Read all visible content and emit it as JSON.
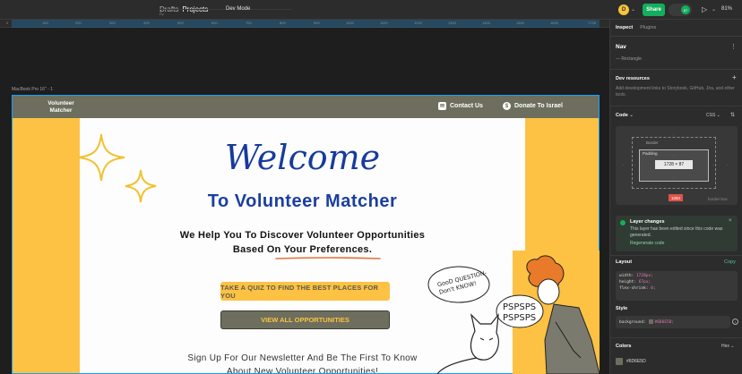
{
  "topbar": {
    "breadcrumb": [
      "Drafts",
      "Projects"
    ],
    "dev_mode": "Dev Mode",
    "avatar_initial": "D",
    "share_label": "Share",
    "users_count": "87",
    "zoom": "81%"
  },
  "ruler": {
    "ticks": [
      "0",
      "100",
      "200",
      "300",
      "400",
      "500",
      "600",
      "700",
      "800",
      "900",
      "1000",
      "1100",
      "1200",
      "1300",
      "1400",
      "1500",
      "1600",
      "1728"
    ]
  },
  "canvas": {
    "frame_label": "MacBook Pro 16\" - 1",
    "site": {
      "logo": "Volunteer Matcher",
      "nav_contact": "Contact Us",
      "nav_donate": "Donate To Israel",
      "welcome": "Welcome",
      "subtitle": "To Volunteer Matcher",
      "tagline_line1": "We Help You To Discover Volunteer Opportunities",
      "tagline_line2": "Based On Your Preferences.",
      "quiz_button": "TAKE A QUIZ TO FIND THE BEST PLACES FOR YOU",
      "opportunities_button": "VIEW ALL OPPORTUNITIES",
      "newsletter_line1": "Sign Up For Our Newsletter And Be The First To Know",
      "newsletter_line2": "About New Volunteer Opportunities!",
      "speech_good_question": "GooD QUESTION-",
      "speech_dont_know": "Don't KNOW!",
      "speech_pspsps_1": "PSPSPS",
      "speech_pspsps_2": "PSPSPS"
    }
  },
  "panel": {
    "tabs": [
      "Inspect",
      "Plugins"
    ],
    "layer_name": "Nav",
    "layer_type": "Rectangle",
    "dev_resources_title": "Dev resources",
    "dev_resources_desc": "Add development links to Storybook, GitHub, Jira, and other tools.",
    "code_title": "Code",
    "code_lang": "CSS",
    "box_border_label": "Border",
    "box_padding_label": "Padding",
    "box_size": "1728 × 87",
    "box_badge": "1050",
    "box_sizing": "border-box",
    "notice_title": "Layer changes",
    "notice_desc": "This layer has been edited since this code was generated.",
    "notice_link": "Regenerate code",
    "layout_title": "Layout",
    "copy_label": "Copy",
    "layout_lines": [
      {
        "k": "width: ",
        "v": "1728px;"
      },
      {
        "k": "height: ",
        "v": "67px;"
      },
      {
        "k": "flex-shrink: ",
        "v": "0;"
      }
    ],
    "style_title": "Style",
    "style_line_key": "background: ",
    "style_line_val": "#6D6E5D;",
    "colors_title": "Colors",
    "color_format": "Hex",
    "color_value": "#6D6E5D",
    "brand_color": "#6D6E5D",
    "accent_color": "#FDC243",
    "share_color": "#14AE5C"
  }
}
